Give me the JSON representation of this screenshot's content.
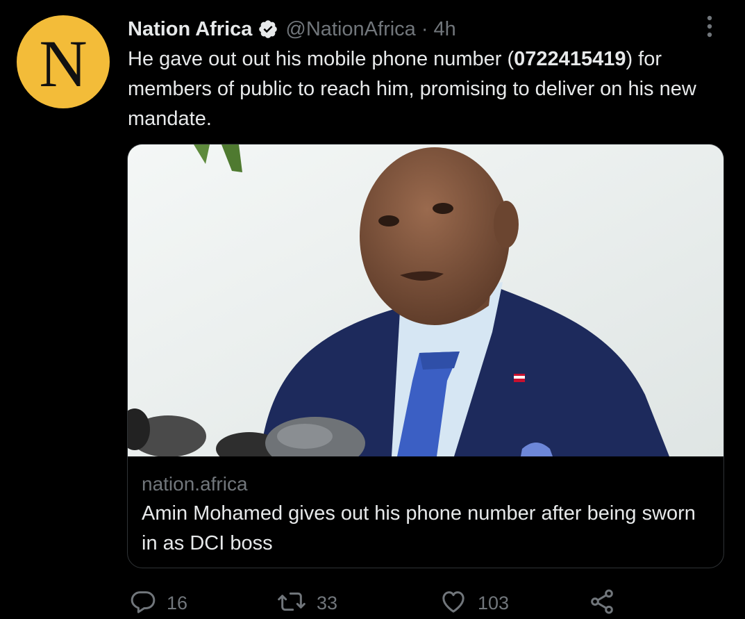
{
  "tweet": {
    "avatar_letter": "N",
    "display_name": "Nation Africa",
    "handle": "@NationAfrica",
    "separator": "·",
    "time": "4h",
    "text_before": "He gave out out his mobile phone number (",
    "phone": "0722415419",
    "text_after": ") for members of public to reach him, promising to deliver on his new mandate."
  },
  "card": {
    "domain": "nation.africa",
    "title": "Amin Mohamed gives out his phone number after being sworn in as DCI boss"
  },
  "actions": {
    "replies": "16",
    "retweets": "33",
    "likes": "103"
  },
  "icons": {
    "verified": "verified-badge-icon",
    "more": "more-vertical-icon",
    "reply": "reply-icon",
    "retweet": "retweet-icon",
    "like": "heart-icon",
    "share": "share-icon"
  },
  "colors": {
    "background": "#000000",
    "text_primary": "#e7e9ea",
    "text_secondary": "#71767b",
    "avatar_bg": "#f3bc39",
    "card_border": "#2f3336"
  }
}
